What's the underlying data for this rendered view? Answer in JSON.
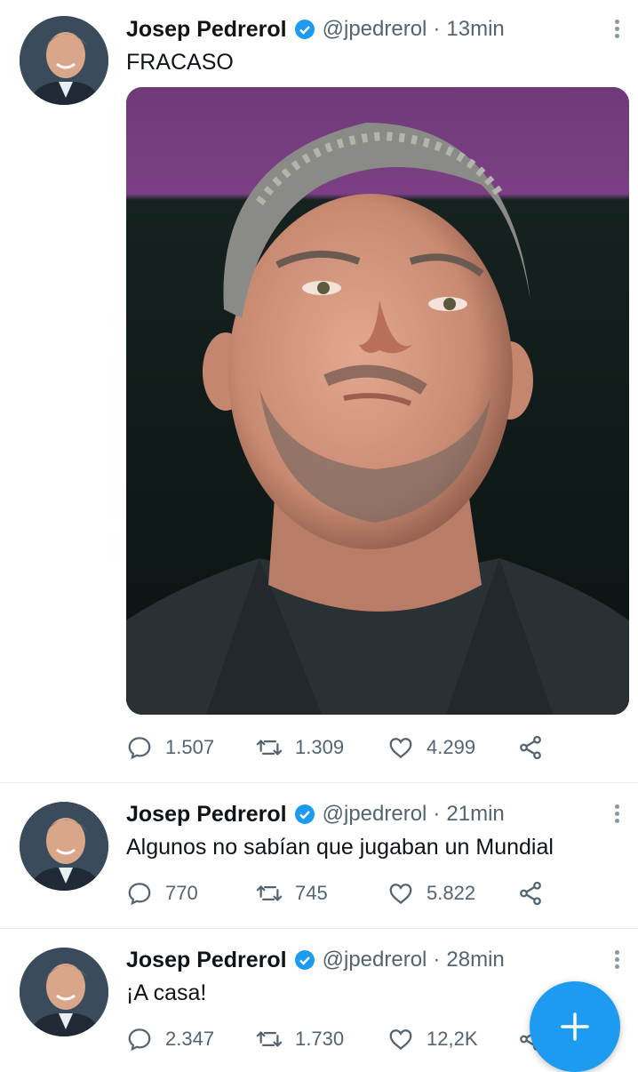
{
  "tweets": [
    {
      "name": "Josep Pedrerol",
      "handle": "@jpedrerol",
      "separator": "·",
      "time": "13min",
      "text": "FRACASO",
      "replies": "1.507",
      "retweets": "1.309",
      "likes": "4.299"
    },
    {
      "name": "Josep Pedrerol",
      "handle": "@jpedrerol",
      "separator": "·",
      "time": "21min",
      "text": "Algunos no sabían que jugaban un Mundial",
      "replies": "770",
      "retweets": "745",
      "likes": "5.822"
    },
    {
      "name": "Josep Pedrerol",
      "handle": "@jpedrerol",
      "separator": "·",
      "time": "28min",
      "text": "¡A casa!",
      "replies": "2.347",
      "retweets": "1.730",
      "likes": "12,2K"
    }
  ],
  "colors": {
    "accent": "#1d9bf0",
    "muted": "#536471",
    "text": "#0f1419"
  },
  "icons": [
    "verified-badge-icon",
    "reply-icon",
    "retweet-icon",
    "like-icon",
    "share-icon",
    "more-icon",
    "compose-plus-icon"
  ]
}
